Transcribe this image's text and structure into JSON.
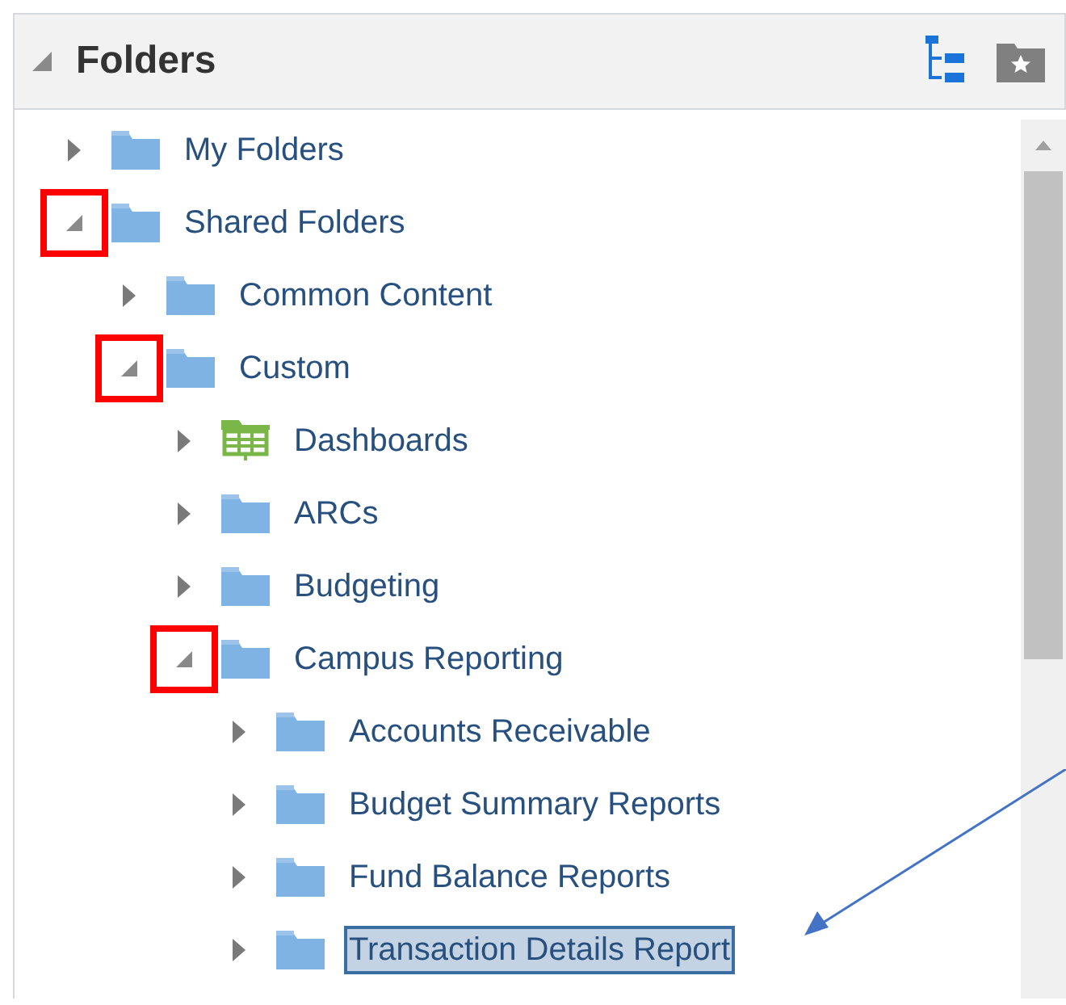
{
  "panel": {
    "title": "Folders",
    "expanded": true
  },
  "tree": [
    {
      "label": "My Folders",
      "kind": "folder",
      "expanded": false,
      "marked": false,
      "selected": false
    },
    {
      "label": "Shared Folders",
      "kind": "folder",
      "expanded": true,
      "marked": true,
      "selected": false,
      "children": [
        {
          "label": "Common Content",
          "kind": "folder",
          "expanded": false,
          "marked": false,
          "selected": false
        },
        {
          "label": "Custom",
          "kind": "folder",
          "expanded": true,
          "marked": true,
          "selected": false,
          "children": [
            {
              "label": "Dashboards",
              "kind": "dashboard",
              "expanded": false,
              "marked": false,
              "selected": false
            },
            {
              "label": "ARCs",
              "kind": "folder",
              "expanded": false,
              "marked": false,
              "selected": false
            },
            {
              "label": "Budgeting",
              "kind": "folder",
              "expanded": false,
              "marked": false,
              "selected": false
            },
            {
              "label": "Campus Reporting",
              "kind": "folder",
              "expanded": true,
              "marked": true,
              "selected": false,
              "children": [
                {
                  "label": "Accounts Receivable",
                  "kind": "folder",
                  "expanded": false,
                  "marked": false,
                  "selected": false
                },
                {
                  "label": "Budget Summary Reports",
                  "kind": "folder",
                  "expanded": false,
                  "marked": false,
                  "selected": false
                },
                {
                  "label": "Fund Balance Reports",
                  "kind": "folder",
                  "expanded": false,
                  "marked": false,
                  "selected": false
                },
                {
                  "label": "Transaction Details Report",
                  "kind": "folder",
                  "expanded": false,
                  "marked": false,
                  "selected": true
                }
              ]
            }
          ]
        }
      ]
    }
  ]
}
